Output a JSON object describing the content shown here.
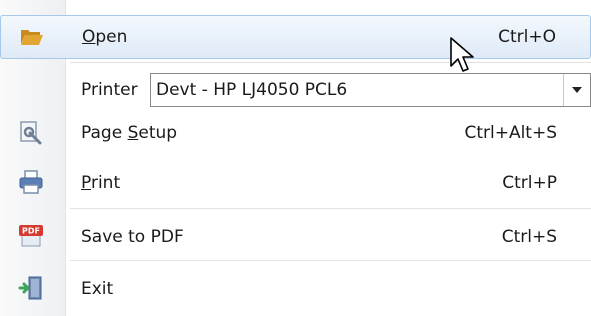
{
  "menu": {
    "open": {
      "pre": "",
      "mnemonic": "O",
      "post": "pen",
      "shortcut": "Ctrl+O",
      "icon": "folder-open-icon"
    },
    "printer": {
      "label": "Printer",
      "selected": "Devt - HP LJ4050 PCL6"
    },
    "page_setup": {
      "pre": "Page ",
      "mnemonic": "S",
      "post": "etup",
      "shortcut": "Ctrl+Alt+S",
      "icon": "page-setup-icon"
    },
    "print": {
      "pre": "",
      "mnemonic": "P",
      "post": "rint",
      "shortcut": "Ctrl+P",
      "icon": "printer-icon"
    },
    "save_pdf": {
      "label": "Save to PDF",
      "shortcut": "Ctrl+S",
      "icon": "pdf-icon",
      "icon_text": "PDF"
    },
    "exit": {
      "label": "Exit",
      "icon": "exit-door-icon"
    }
  },
  "colors": {
    "hover_border": "#a8c8eb",
    "hover_fill": "#dfeaf7",
    "pdf_red": "#d63b2f",
    "exit_green": "#3aa55a",
    "folder": "#e3a531"
  }
}
